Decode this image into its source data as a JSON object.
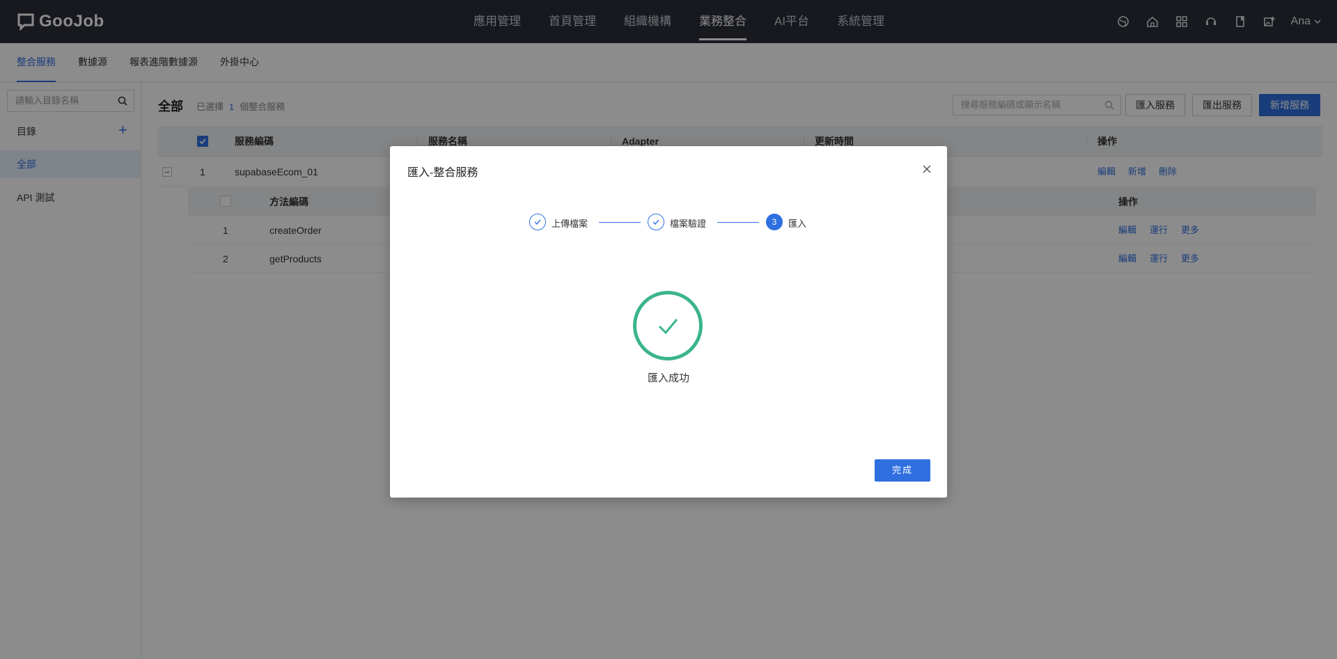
{
  "app": {
    "brand": "GooJob",
    "user": "Ana"
  },
  "topnav": [
    "應用管理",
    "首頁管理",
    "組織機構",
    "業務整合",
    "AI平台",
    "系統管理"
  ],
  "subtabs": [
    "整合服務",
    "數據源",
    "報表進階數據源",
    "外掛中心"
  ],
  "sidebar": {
    "search_placeholder": "請輸入目錄名稱",
    "heading": "目錄",
    "items": [
      "全部",
      "API 測試"
    ]
  },
  "main": {
    "title": "全部",
    "selected_prefix": "已選擇",
    "selected_count": "1",
    "selected_suffix": "個整合服務",
    "search_placeholder": "搜尋服務編碼或顯示名稱",
    "import_label": "匯入服務",
    "export_label": "匯出服務",
    "new_label": "新增服務",
    "columns": [
      "服務編碼",
      "服務名稱",
      "Adapter",
      "更新時間",
      "操作"
    ],
    "rows": [
      {
        "index": "1",
        "code": "supabaseEcom_01",
        "actions": [
          "編輯",
          "新增",
          "刪除"
        ]
      }
    ],
    "sub_columns": [
      "方法編碼",
      "操作"
    ],
    "sub_rows": [
      {
        "index": "1",
        "code": "createOrder",
        "actions": [
          "編輯",
          "運行",
          "更多"
        ]
      },
      {
        "index": "2",
        "code": "getProducts",
        "actions": [
          "編輯",
          "運行",
          "更多"
        ]
      }
    ]
  },
  "modal": {
    "title": "匯入-整合服務",
    "steps": [
      {
        "label": "上傳檔案",
        "status": "done"
      },
      {
        "label": "檔案驗證",
        "status": "done"
      },
      {
        "label": "匯入",
        "status": "current",
        "number": "3"
      }
    ],
    "result_text": "匯入成功",
    "done_label": "完成"
  },
  "colors": {
    "primary": "#2f6fe0",
    "success": "#3bb589",
    "topbar": "#2a2f3a"
  }
}
